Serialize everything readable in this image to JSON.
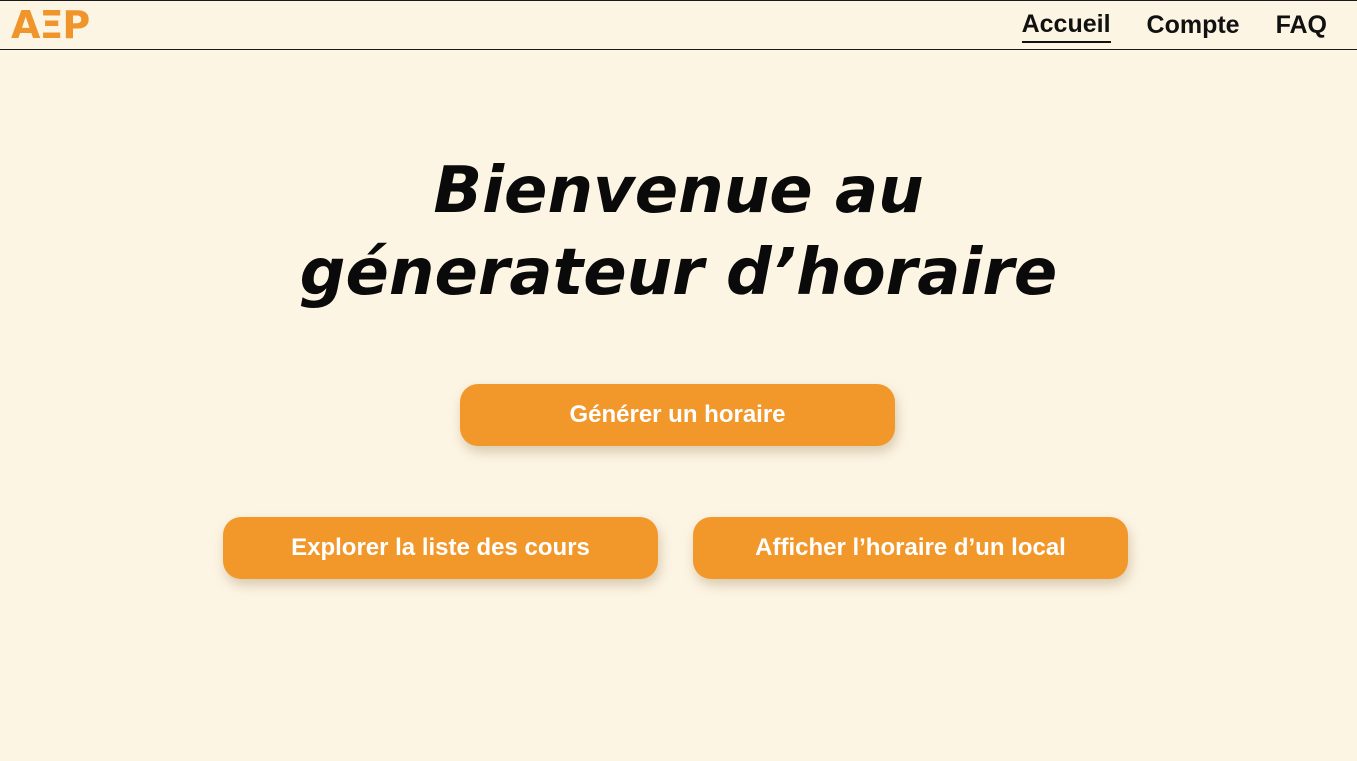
{
  "header": {
    "logo": "AΞP",
    "nav": [
      {
        "label": "Accueil",
        "active": true
      },
      {
        "label": "Compte",
        "active": false
      },
      {
        "label": "FAQ",
        "active": false
      }
    ]
  },
  "main": {
    "title_line1": "Bienvenue au",
    "title_line2": "génerateur d’horaire",
    "buttons": {
      "generate": "Générer un horaire",
      "explore": "Explorer la liste des cours",
      "room_schedule": "Afficher l’horaire d’un local"
    }
  },
  "colors": {
    "accent": "#f2982b",
    "background": "#fdf5e4",
    "text": "#0a0a0a"
  }
}
